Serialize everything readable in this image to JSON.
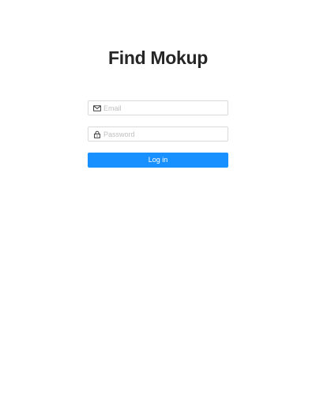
{
  "page": {
    "title": "Find Mokup"
  },
  "login_form": {
    "email": {
      "placeholder": "Email",
      "value": "",
      "icon": "mail-icon"
    },
    "password": {
      "placeholder": "Password",
      "value": "",
      "icon": "lock-icon"
    },
    "submit_label": "Log in"
  },
  "colors": {
    "primary": "#1890ff",
    "border": "#d9d9d9",
    "placeholder": "#bfbfbf",
    "text": "#262626"
  }
}
